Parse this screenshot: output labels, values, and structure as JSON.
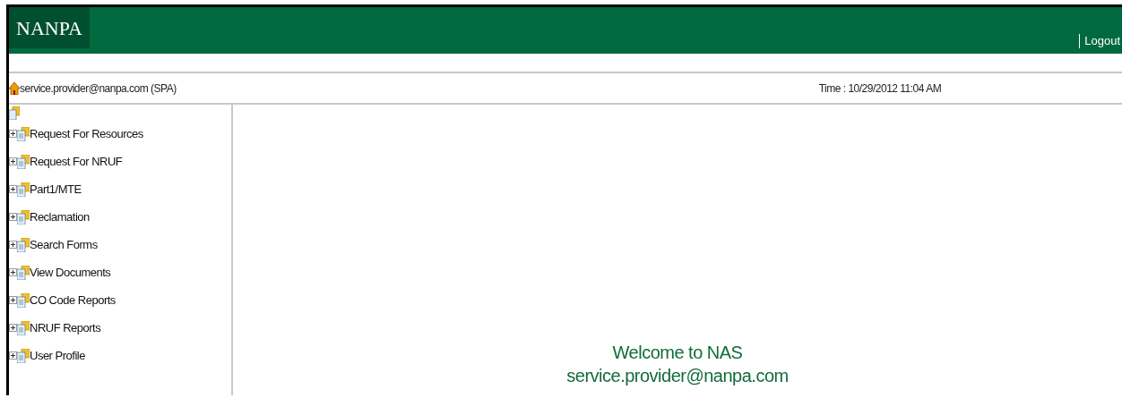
{
  "header": {
    "logo": "NANPA",
    "logout": "Logout"
  },
  "user_bar": {
    "user": "service.provider@nanpa.com (SPA)",
    "time": "Time : 10/29/2012 11:04 AM"
  },
  "tree": {
    "items": [
      {
        "label": "Request For Resources",
        "expanded": false
      },
      {
        "label": "Request For NRUF",
        "expanded": false
      },
      {
        "label": "Part1/MTE",
        "expanded": false
      },
      {
        "label": "Reclamation",
        "expanded": false
      },
      {
        "label": "Search Forms",
        "expanded": false
      },
      {
        "label": "View Documents",
        "expanded": false
      },
      {
        "label": "CO Code Reports",
        "expanded": false
      },
      {
        "label": "NRUF Reports",
        "expanded": false
      },
      {
        "label": "User Profile",
        "expanded": false
      }
    ]
  },
  "welcome": {
    "title": "Welcome to NAS",
    "user": "service.provider@nanpa.com"
  }
}
